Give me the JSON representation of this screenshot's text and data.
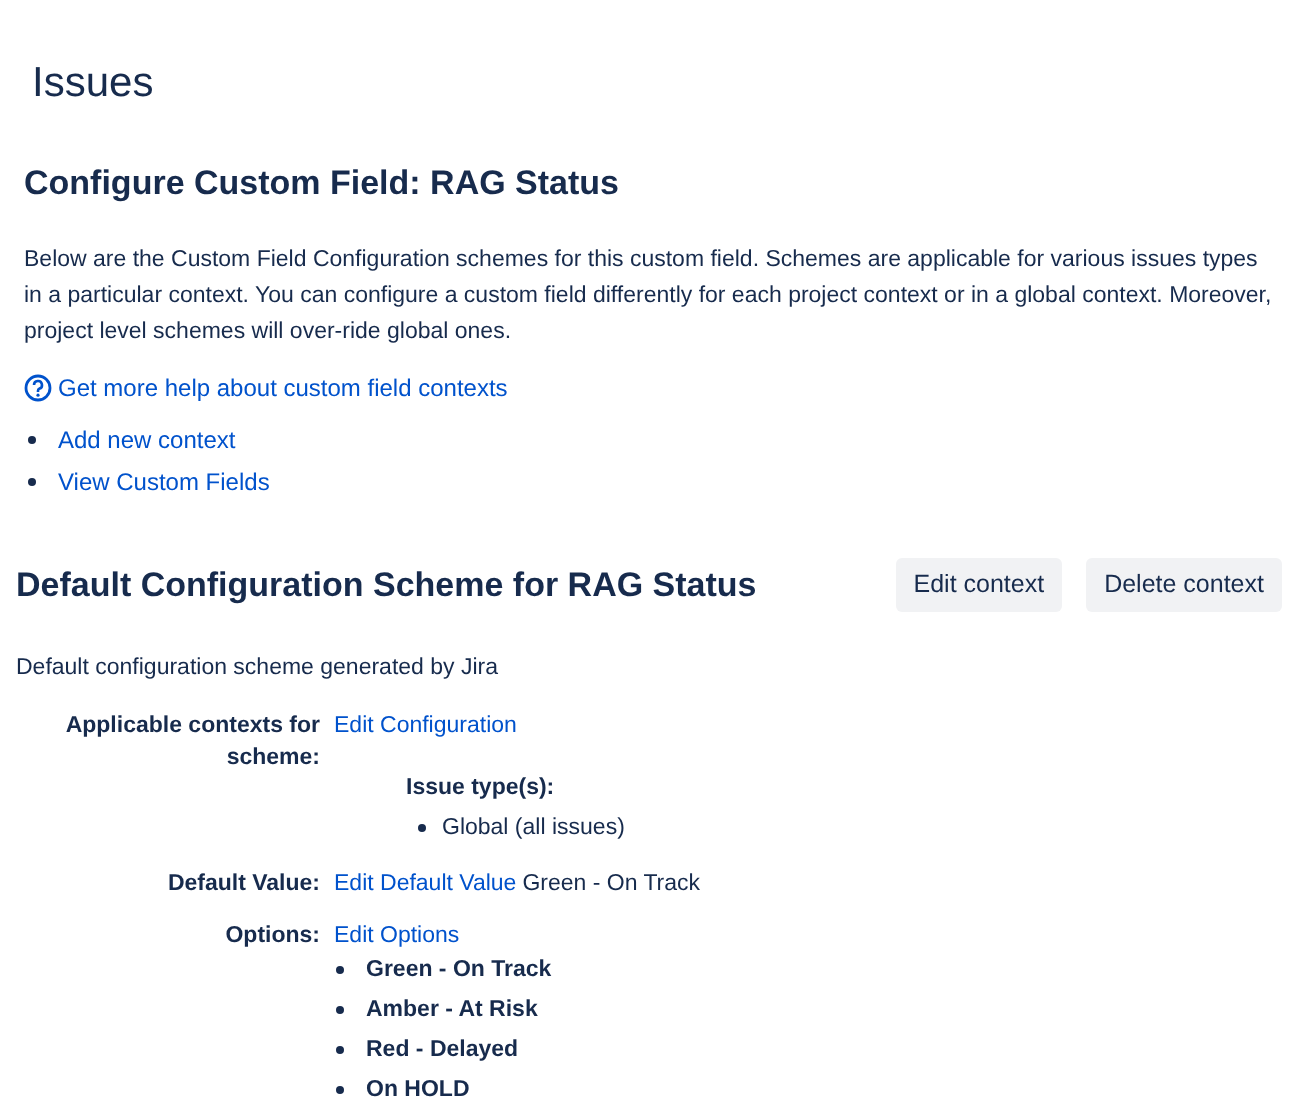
{
  "page_title": "Issues",
  "heading": "Configure Custom Field: RAG Status",
  "intro": "Below are the Custom Field Configuration schemes for this custom field. Schemes are applicable for various issues types in a particular context. You can configure a custom field differently for each project context or in a global context. Moreover, project level schemes will over-ride global ones.",
  "help_link": "Get more help about custom field contexts",
  "links": [
    "Add new context",
    "View Custom Fields"
  ],
  "scheme": {
    "title": "Default Configuration Scheme for RAG Status",
    "buttons": [
      "Edit context",
      "Delete context"
    ],
    "description": "Default configuration scheme generated by Jira",
    "contexts": {
      "label": "Applicable contexts for scheme:",
      "link": "Edit Configuration",
      "issue_types_label": "Issue type(s):",
      "issue_types": [
        "Global (all issues)"
      ]
    },
    "default_value": {
      "label": "Default Value:",
      "link": "Edit Default Value",
      "value": "Green - On Track"
    },
    "options": {
      "label": "Options:",
      "link": "Edit Options",
      "items": [
        "Green - On Track",
        "Amber - At Risk",
        "Red - Delayed",
        "On HOLD"
      ]
    }
  }
}
